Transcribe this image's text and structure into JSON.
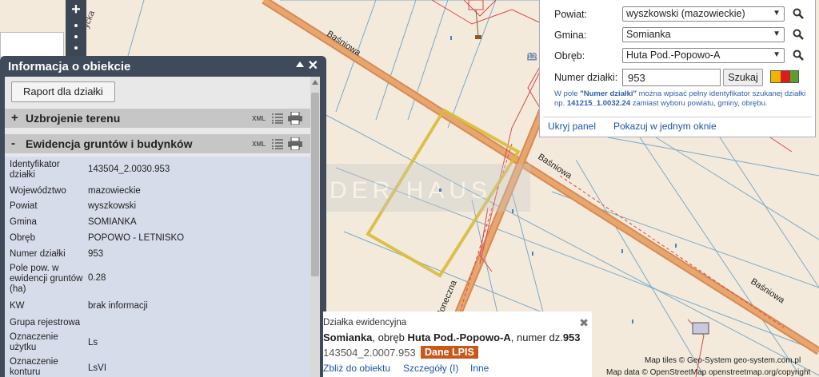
{
  "map": {
    "streets": [
      "Baśniowa",
      "Baśniowa",
      "Baśniowa",
      "Słoneczna"
    ],
    "watermark": "LIDER HAUS",
    "marker": "12"
  },
  "info_panel": {
    "title": "Informacja o obiekcie",
    "report_button": "Raport dla działki",
    "sections": [
      {
        "sign": "+",
        "title": "Uzbrojenie terenu",
        "xml": "XML"
      },
      {
        "sign": "-",
        "title": "Ewidencja gruntów i budynków",
        "xml": "XML"
      }
    ],
    "rows": [
      {
        "label": "Identyfikator działki",
        "value": "143504_2.0030.953"
      },
      {
        "label": "Województwo",
        "value": "mazowieckie"
      },
      {
        "label": "Powiat",
        "value": "wyszkowski"
      },
      {
        "label": "Gmina",
        "value": "SOMIANKA"
      },
      {
        "label": "Obręb",
        "value": "POPOWO - LETNISKO"
      },
      {
        "label": "Numer działki",
        "value": "953"
      },
      {
        "label": "Pole pow. w ewidencji gruntów (ha)",
        "value": "0.28"
      },
      {
        "label": "KW",
        "value": "brak informacji"
      },
      {
        "label": "Grupa rejestrowa",
        "value": ""
      },
      {
        "label": "Oznaczenie użytku",
        "value": "Ls"
      },
      {
        "label": "Oznaczenie konturu",
        "value": "LsVI"
      }
    ]
  },
  "search_panel": {
    "powiat_label": "Powiat:",
    "powiat_value": "wyszkowski (mazowieckie)",
    "gmina_label": "Gmina:",
    "gmina_value": "Somianka",
    "obreb_label": "Obręb:",
    "obreb_value": "Huta Pod.-Popowo-A",
    "numer_label": "Numer działki:",
    "numer_value": "953",
    "search_button": "Szukaj",
    "hint_a": "W pole ",
    "hint_b": "\"Numer działki\"",
    "hint_c": " można wpisać pełny identyfikator szukanej działki np. ",
    "hint_d": "141215_1.0032.24",
    "hint_e": " zamiast wyboru powiatu, gminy, obrębu.",
    "hide_link": "Ukryj panel",
    "single_window_link": "Pokazuj w jednym oknie",
    "swatch_colors": [
      "#f0b400",
      "#d91c1c",
      "#5aa02c"
    ]
  },
  "popup": {
    "subtitle": "Działka ewidencyjna",
    "gmina": "Somianka",
    "sep1": ", obręb ",
    "obreb": "Huta Pod.-Popowo-A",
    "sep2": ", numer dz.",
    "numer": "953",
    "id": "143504_2.0007.953",
    "lpis_badge": "Dane LPIS",
    "links": [
      "Zbliż do obiektu",
      "Szczegóły (I)",
      "Inne"
    ]
  },
  "attribution": {
    "tiles": "Map tiles © Geo-System geo-system.com.pl",
    "data": "Map data © OpenStreetMap openstreetmap.org/copyright"
  }
}
